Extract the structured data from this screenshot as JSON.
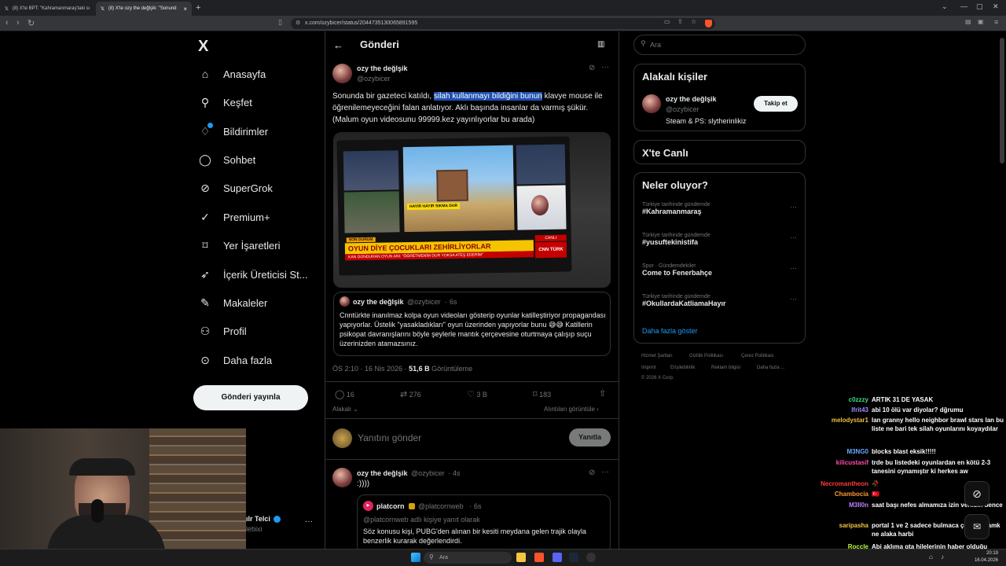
{
  "browser": {
    "tabs": [
      {
        "label": "(8) X'te BPT: \"Kahramanmaraş'taki sı"
      },
      {
        "label": "(8) X'te ozy the değlşik: \"Sonund"
      }
    ],
    "new_tab": "+",
    "url": "x.com/ozybicer/status/2044735130065891595"
  },
  "nav": {
    "logo": "X",
    "items": [
      {
        "label": "Anasayfa",
        "icon": "home-icon"
      },
      {
        "label": "Keşfet",
        "icon": "search-icon"
      },
      {
        "label": "Bildirimler",
        "icon": "bell-icon"
      },
      {
        "label": "Sohbet",
        "icon": "chat-icon"
      },
      {
        "label": "SuperGrok",
        "icon": "grok-icon"
      },
      {
        "label": "Premium+",
        "icon": "premium-icon"
      },
      {
        "label": "Yer İşaretleri",
        "icon": "bookmark-icon"
      },
      {
        "label": "İçerik Üreticisi St...",
        "icon": "rocket-icon"
      },
      {
        "label": "Makaleler",
        "icon": "article-icon"
      },
      {
        "label": "Profil",
        "icon": "person-icon"
      },
      {
        "label": "Daha fazla",
        "icon": "more-circle-icon"
      }
    ],
    "post_button": "Gönderi yayınla",
    "account_name": "ılr Telci",
    "account_handle": "lebixi"
  },
  "header": {
    "title": "Gönderi"
  },
  "post": {
    "author": "ozy the değlşik",
    "handle": "@ozybicer",
    "text_before": "Sonunda bir gazeteci katıldı, ",
    "text_selected": "silah kullanmayı bildiğini bunun",
    "text_after": " klavye mouse ile öğrenilemeyeceğini falan anlatıyor.  Aklı başında insanlar da varmış şükür. (Malum oyun videosunu 99999.kez yayınlıyorlar bu arada)",
    "image": {
      "banner_top": "SON DURUM",
      "headline": "OYUN DİYE ÇOCUKLARI ZEHİRLİYORLAR",
      "subline": "KAN DONDURAN OYUN ANI: \"ÖĞRETMENİM DUR YOKSA ATEŞ EDERİM\"",
      "game_caption": "HAYIR HAYIR SIKMA DUR",
      "channel": "CNN TÜRK",
      "live": "CANLI"
    },
    "quote": {
      "author": "ozy the değlşik",
      "handle": "@ozybicer",
      "time": "6s",
      "text": "Cnntürkte inanılmaz kolpa oyun videoları gösterip oyunlar katilleştiriyor propagandası yapıyorlar. Üstelik \"yasakladıkları\" oyun üzerinden yapıyorlar bunu 😅😅 Katillerin psikopat davranışlarını böyle şeylerle mantık çerçevesine oturtmaya çalışıp suçu üzerinizden atamazsınız."
    },
    "timestamp": "ÖS 2:10 · 16 Nis 2026 · ",
    "views": "51,6 B",
    "views_label": " Görüntüleme",
    "stats": {
      "replies": "16",
      "reposts": "276",
      "likes": "3 B",
      "bookmarks": "183"
    },
    "related_label": "Alakalı",
    "quotes_label": "Alıntıları görüntüle"
  },
  "reply_box": {
    "placeholder": "Yanıtını gönder",
    "button": "Yanıtla"
  },
  "reply": {
    "author": "ozy the değlşik",
    "handle": "@ozybicer",
    "time": "4s",
    "text": ":))))",
    "quote": {
      "author": "platcorn",
      "handle": "@platcornweb",
      "time": "6s",
      "reply_to": "@platcornweb adlı kişiye yanıt olarak",
      "text": "Söz konusu kişi, PUBG'den alınan bir kesiti meydana gelen trajik olayla benzerlik kurarak değerlendirdi."
    }
  },
  "right": {
    "search_placeholder": "Ara",
    "related_title": "Alakalı kişiler",
    "person": {
      "name": "ozy the değlşik",
      "handle": "@ozybicer",
      "bio": "Steam & PS: slytherinlikiz",
      "follow": "Takip et"
    },
    "live_title": "X'te Canlı",
    "trends_title": "Neler oluyor?",
    "trends": [
      {
        "meta": "Türkiye tarihinde gündemde",
        "name": "#Kahramanmaraş"
      },
      {
        "meta": "Türkiye tarihinde gündemde",
        "name": "#yusuftekinistifa"
      },
      {
        "meta": "Spor · Gündemdekiler",
        "name": "Come to Fenerbahçe"
      },
      {
        "meta": "Türkiye tarihinde gündemde",
        "name": "#OkullardaKatliamaHayır"
      }
    ],
    "show_more": "Daha fazla göster",
    "footer": [
      "Hizmet Şartları",
      "Gizlilik Politikası",
      "Çerez Politikası",
      "Imprint",
      "Erişilebilirlik",
      "Reklam bilgisi",
      "Daha fazla ...",
      "© 2026 X Corp."
    ]
  },
  "chat": [
    {
      "user": "c0zzzy",
      "color": "#3ddc84",
      "msg": "ARTIK 31 DE YASAK"
    },
    {
      "user": "Ifrit43",
      "color": "#9b8cff",
      "msg": "abi 10 ölü var diyolar? dğrumu"
    },
    {
      "user": "melodystar1",
      "color": "#f0c040",
      "msg": "lan granny hello neighbor brawl stars lan bu liste ne bari tek silah oyunlarını koyaydılar"
    },
    {
      "user": "M3NG0",
      "color": "#6aa8ff",
      "msg": "blocks blast eksik!!!!!"
    },
    {
      "user": "kilicustasif",
      "color": "#ff4da6",
      "msg": "trde bu listedeki oyunlardan en kötü 2-3 tanesini oynamıştır ki herkes aw"
    },
    {
      "user": "Necromantheon",
      "color": "#ff3b3b",
      "msg": "🥀"
    },
    {
      "user": "Chambocia",
      "color": "#ff9a2e",
      "msg": "🇹🇷"
    },
    {
      "user": "M3ll0n",
      "color": "#c080ff",
      "msg": "saat başı nefes almamıza izin verilsin bence"
    },
    {
      "user": "saripasha",
      "color": "#f5c542",
      "msg": "portal 1 ve 2 sadece bulmaca çözüyon amk ne alaka harbi"
    },
    {
      "user": "Roccle",
      "color": "#b6ff3c",
      "msg": "Abi aklıma gta hilelerinin haber olduğu zaman geldi ya"
    }
  ],
  "taskbar": {
    "search": "Ara",
    "time": "20:19",
    "date": "16.04.2026"
  }
}
